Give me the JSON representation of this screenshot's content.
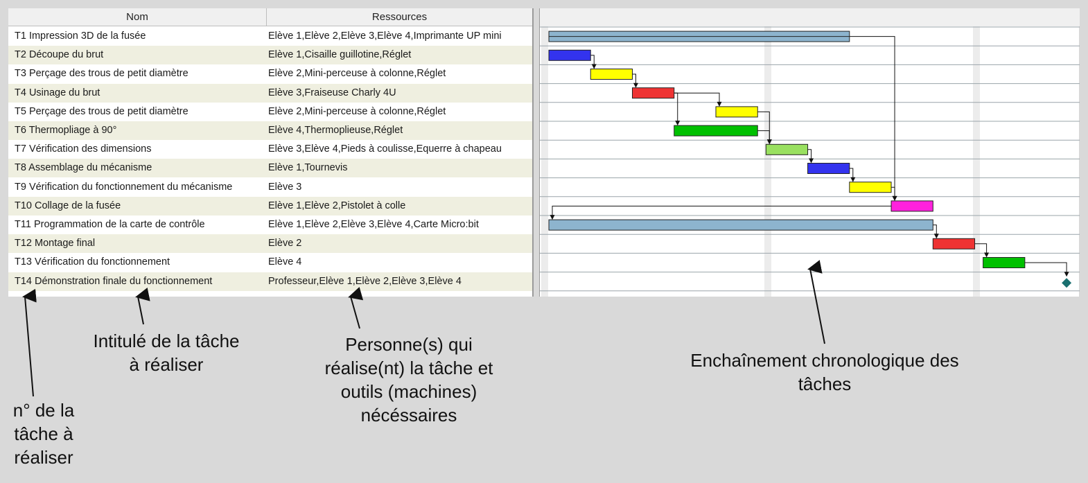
{
  "table": {
    "columns": {
      "nom": "Nom",
      "ressources": "Ressources"
    },
    "rows": [
      {
        "nom": "T1 Impression 3D de la fusée",
        "ressources": "Elève 1,Elève 2,Elève 3,Elève 4,Imprimante UP mini"
      },
      {
        "nom": "T2 Découpe du brut",
        "ressources": "Elève 1,Cisaille guillotine,Réglet"
      },
      {
        "nom": "T3 Perçage des trous de petit diamètre",
        "ressources": "Elève 2,Mini-perceuse à colonne,Réglet"
      },
      {
        "nom": "T4 Usinage du brut",
        "ressources": "Elève 3,Fraiseuse Charly 4U"
      },
      {
        "nom": "T5 Perçage des trous de petit diamètre",
        "ressources": "Elève 2,Mini-perceuse à colonne,Réglet"
      },
      {
        "nom": "T6 Thermopliage à 90°",
        "ressources": "Elève 4,Thermoplieuse,Réglet"
      },
      {
        "nom": "T7 Vérification des dimensions",
        "ressources": "Elève 3,Elève 4,Pieds à coulisse,Equerre à chapeau"
      },
      {
        "nom": "T8 Assemblage du mécanisme",
        "ressources": "Elève 1,Tournevis"
      },
      {
        "nom": "T9 Vérification du fonctionnement du mécanisme",
        "ressources": "Elève 3"
      },
      {
        "nom": "T10 Collage de la fusée",
        "ressources": "Elève 1,Elève 2,Pistolet à colle"
      },
      {
        "nom": "T11 Programmation de la carte de contrôle",
        "ressources": "Elève 1,Elève 2,Elève 3,Elève 4,Carte Micro:bit"
      },
      {
        "nom": "T12 Montage final",
        "ressources": "Elève 2"
      },
      {
        "nom": "T13 Vérification du fonctionnement",
        "ressources": "Elève 4"
      },
      {
        "nom": "T14 Démonstration finale du fonctionnement",
        "ressources": "Professeur,Elève 1,Elève 2,Elève 3,Elève 4"
      }
    ]
  },
  "gantt": {
    "tasks": [
      {
        "start": 0,
        "duration": 36,
        "color": "#8db4ce",
        "split": true
      },
      {
        "start": 0,
        "duration": 5,
        "color": "#3333ee"
      },
      {
        "start": 5,
        "duration": 5,
        "color": "#ffff00"
      },
      {
        "start": 10,
        "duration": 5,
        "color": "#ee3333"
      },
      {
        "start": 20,
        "duration": 5,
        "color": "#ffff00"
      },
      {
        "start": 15,
        "duration": 10,
        "color": "#00c000"
      },
      {
        "start": 26,
        "duration": 5,
        "color": "#99e060"
      },
      {
        "start": 31,
        "duration": 5,
        "color": "#3333ee"
      },
      {
        "start": 36,
        "duration": 5,
        "color": "#ffff00"
      },
      {
        "start": 41,
        "duration": 5,
        "color": "#ff22dd"
      },
      {
        "start": 0,
        "duration": 46,
        "color": "#8db4ce"
      },
      {
        "start": 46,
        "duration": 5,
        "color": "#ee3333"
      },
      {
        "start": 52,
        "duration": 5,
        "color": "#00c000"
      },
      {
        "start": 62,
        "duration": 0,
        "color": "#1a7070",
        "milestone": true
      }
    ],
    "links": [
      [
        0,
        9
      ],
      [
        1,
        2
      ],
      [
        2,
        3
      ],
      [
        3,
        4
      ],
      [
        3,
        5
      ],
      [
        4,
        6
      ],
      [
        5,
        6
      ],
      [
        6,
        7
      ],
      [
        7,
        8
      ],
      [
        8,
        9
      ],
      [
        9,
        10
      ],
      [
        10,
        11
      ],
      [
        11,
        12
      ],
      [
        12,
        13
      ]
    ]
  },
  "annotations": {
    "num": "n° de la tâche à réaliser",
    "intitule": "Intitulé de la tâche à réaliser",
    "personnes": "Personne(s) qui réalise(nt) la tâche et outils (machines) nécéssaires",
    "enchainement": "Enchaînement chronologique des tâches"
  }
}
